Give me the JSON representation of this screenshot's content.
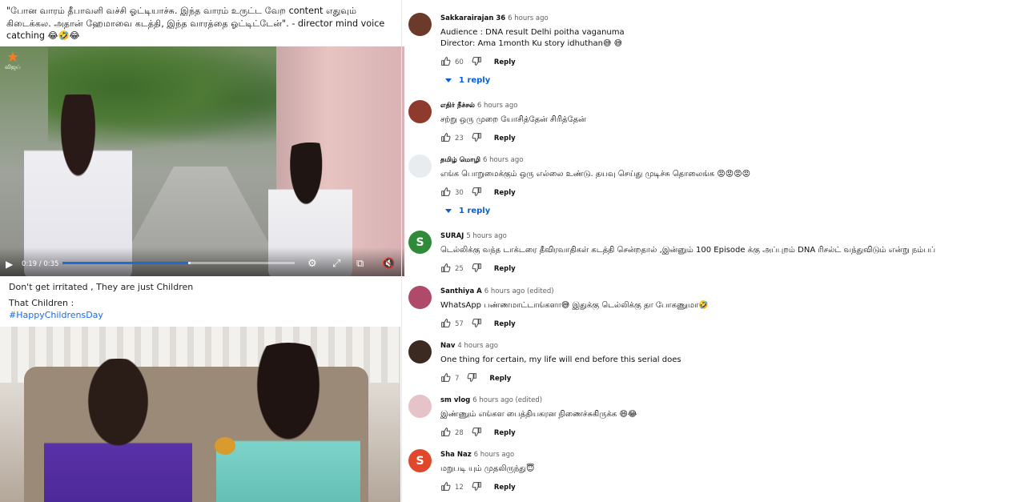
{
  "left": {
    "post1_text": "\"போன வாரம் தீபாவளி வச்சி ஓட்டியாச்சு. இந்த வாரம் உருட்ட வேற content எதுவும் கிடைக்கல. அதான் ஹேமாவை கடத்தி, இந்த வாரத்தை ஓட்டிட்டேன்\". - director mind voice catching 😂🤣😂",
    "channel_logo_text": "விஜய்",
    "player": {
      "time": "0:19 / 0:35",
      "progress": 0.543,
      "buffered": 0.55
    },
    "post2_line1": "Don't get irritated , They are just Children",
    "post2_line2": "That Children :",
    "post2_hashtag": "#HappyChildrensDay"
  },
  "comments": [
    {
      "name": "Sakkarairajan 36",
      "time": "6 hours ago",
      "lines": [
        "Audience : DNA result Delhi poitha vaganuma",
        "Director: Ama 1month Ku story idhuthan😅 😅"
      ],
      "likes": "60",
      "reply_label": "Reply",
      "replies": "1 reply",
      "avatar_color": "#6b3a2a",
      "avatar_letter": ""
    },
    {
      "name": "எதிர் நீச்சல்",
      "time": "6 hours ago",
      "lines": [
        "சற்று ஒரு முறை யோசித்தேன் சிரித்தேன்"
      ],
      "likes": "23",
      "reply_label": "Reply",
      "replies": "",
      "avatar_color": "#8e3a2c",
      "avatar_letter": ""
    },
    {
      "name": "தமிழ் மொழி",
      "time": "6 hours ago",
      "lines": [
        "எங்க பொறுமைக்கும் ஒரு எல்லை உண்டு. தயவு செய்து முடிச்சு தொலைங்க 😡😡😡😡"
      ],
      "likes": "30",
      "reply_label": "Reply",
      "replies": "1 reply",
      "avatar_color": "#e8ecef",
      "avatar_letter": ""
    },
    {
      "name": "SURAJ",
      "time": "5 hours ago",
      "lines": [
        "டெல்லிக்கு வந்த டாக்டரை தீவிரவாதிகள் கடத்தி சென்றதால் ,இன்னும் 100 Episode க்கு அப்புறம் DNA ரிசல்ட் வந்துவிடும் என்று நம்பப்"
      ],
      "likes": "25",
      "reply_label": "Reply",
      "replies": "",
      "avatar_color": "#2f8a3a",
      "avatar_letter": "S"
    },
    {
      "name": "Santhiya A",
      "time": "6 hours ago (edited)",
      "lines": [
        "WhatsApp பண்ணமாட்டாங்களா😅 இதுக்கு டெல்லிக்கு தா போகணுமா🤣"
      ],
      "likes": "57",
      "reply_label": "Reply",
      "replies": "",
      "avatar_color": "#b04a6a",
      "avatar_letter": ""
    },
    {
      "name": "Nav",
      "time": "4 hours ago",
      "lines": [
        "One thing for certain, my life will end before this serial does"
      ],
      "likes": "7",
      "reply_label": "Reply",
      "replies": "",
      "avatar_color": "#3a2a22",
      "avatar_letter": ""
    },
    {
      "name": "sm vlog",
      "time": "6 hours ago (edited)",
      "lines": [
        "இண்ணும் எங்கள பைத்தியகரன நிணைச்சுகிருக்க 😄😂"
      ],
      "likes": "28",
      "reply_label": "Reply",
      "replies": "",
      "avatar_color": "#e6c3c8",
      "avatar_letter": ""
    },
    {
      "name": "Sha Naz",
      "time": "6 hours ago",
      "lines": [
        "மறுபடி யும் முதலிருந்து😇"
      ],
      "likes": "12",
      "reply_label": "Reply",
      "replies": "",
      "avatar_color": "#e0482c",
      "avatar_letter": "S"
    }
  ]
}
